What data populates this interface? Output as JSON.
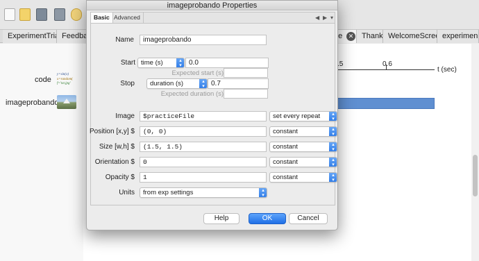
{
  "builder": {
    "routine_tabs": [
      {
        "label": "ExperimentTrial"
      },
      {
        "label": "Feedback"
      },
      {
        "label": "ne"
      },
      {
        "label": "Thanks"
      },
      {
        "label": "WelcomeScreen"
      },
      {
        "label": "experimen"
      }
    ],
    "components": [
      {
        "label": "code",
        "icon": "code-component-icon",
        "icon_lines": [
          "y=sin(x)",
          "x=random(",
          "f='txt.jpg'"
        ]
      },
      {
        "label": "imageprobando",
        "icon": "image-component-icon"
      }
    ],
    "timeline": {
      "tick_labels": [
        ".5",
        "0.6"
      ],
      "axis_label": "t (sec)"
    }
  },
  "dialog": {
    "title": "imageprobando Properties",
    "tabs": [
      {
        "label": "Basic",
        "active": true
      },
      {
        "label": "Advanced",
        "active": false
      }
    ],
    "name": {
      "label": "Name",
      "value": "imageprobando"
    },
    "start": {
      "label": "Start",
      "type": "time (s)",
      "value": "0.0",
      "expected_label": "Expected start (s)",
      "expected_value": ""
    },
    "stop": {
      "label": "Stop",
      "type": "duration (s)",
      "value": "0.7",
      "expected_label": "Expected duration (s)",
      "expected_value": ""
    },
    "image": {
      "label": "Image",
      "value": "$practiceFile",
      "update": "set every repeat"
    },
    "position": {
      "label": "Position [x,y] $",
      "value": "(0, 0)",
      "update": "constant"
    },
    "size": {
      "label": "Size [w,h] $",
      "value": "(1.5, 1.5)",
      "update": "constant"
    },
    "orientation": {
      "label": "Orientation $",
      "value": "0",
      "update": "constant"
    },
    "opacity": {
      "label": "Opacity $",
      "value": "1",
      "update": "constant"
    },
    "units": {
      "label": "Units",
      "value": "from exp settings"
    },
    "buttons": {
      "help": "Help",
      "ok": "OK",
      "cancel": "Cancel"
    }
  }
}
